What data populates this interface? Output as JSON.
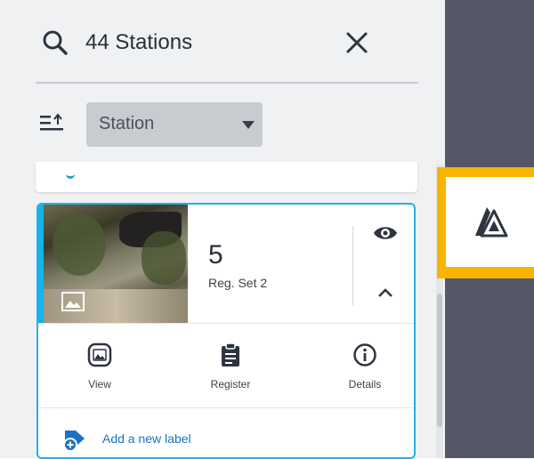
{
  "search": {
    "results_text": "44 Stations"
  },
  "sort": {
    "selected": "Station"
  },
  "card": {
    "number": "5",
    "reg_set": "Reg. Set 2",
    "actions": [
      {
        "label": "View",
        "icon": "image-frame-icon"
      },
      {
        "label": "Register",
        "icon": "clipboard-icon"
      },
      {
        "label": "Details",
        "icon": "info-icon"
      }
    ],
    "add_label": "Add a new label"
  },
  "colors": {
    "accent": "#26aee8",
    "highlight": "#f7b500",
    "link": "#1a73c8",
    "dark_sidebar": "#565766"
  },
  "tool": {
    "icon": "registration-tool-icon"
  }
}
